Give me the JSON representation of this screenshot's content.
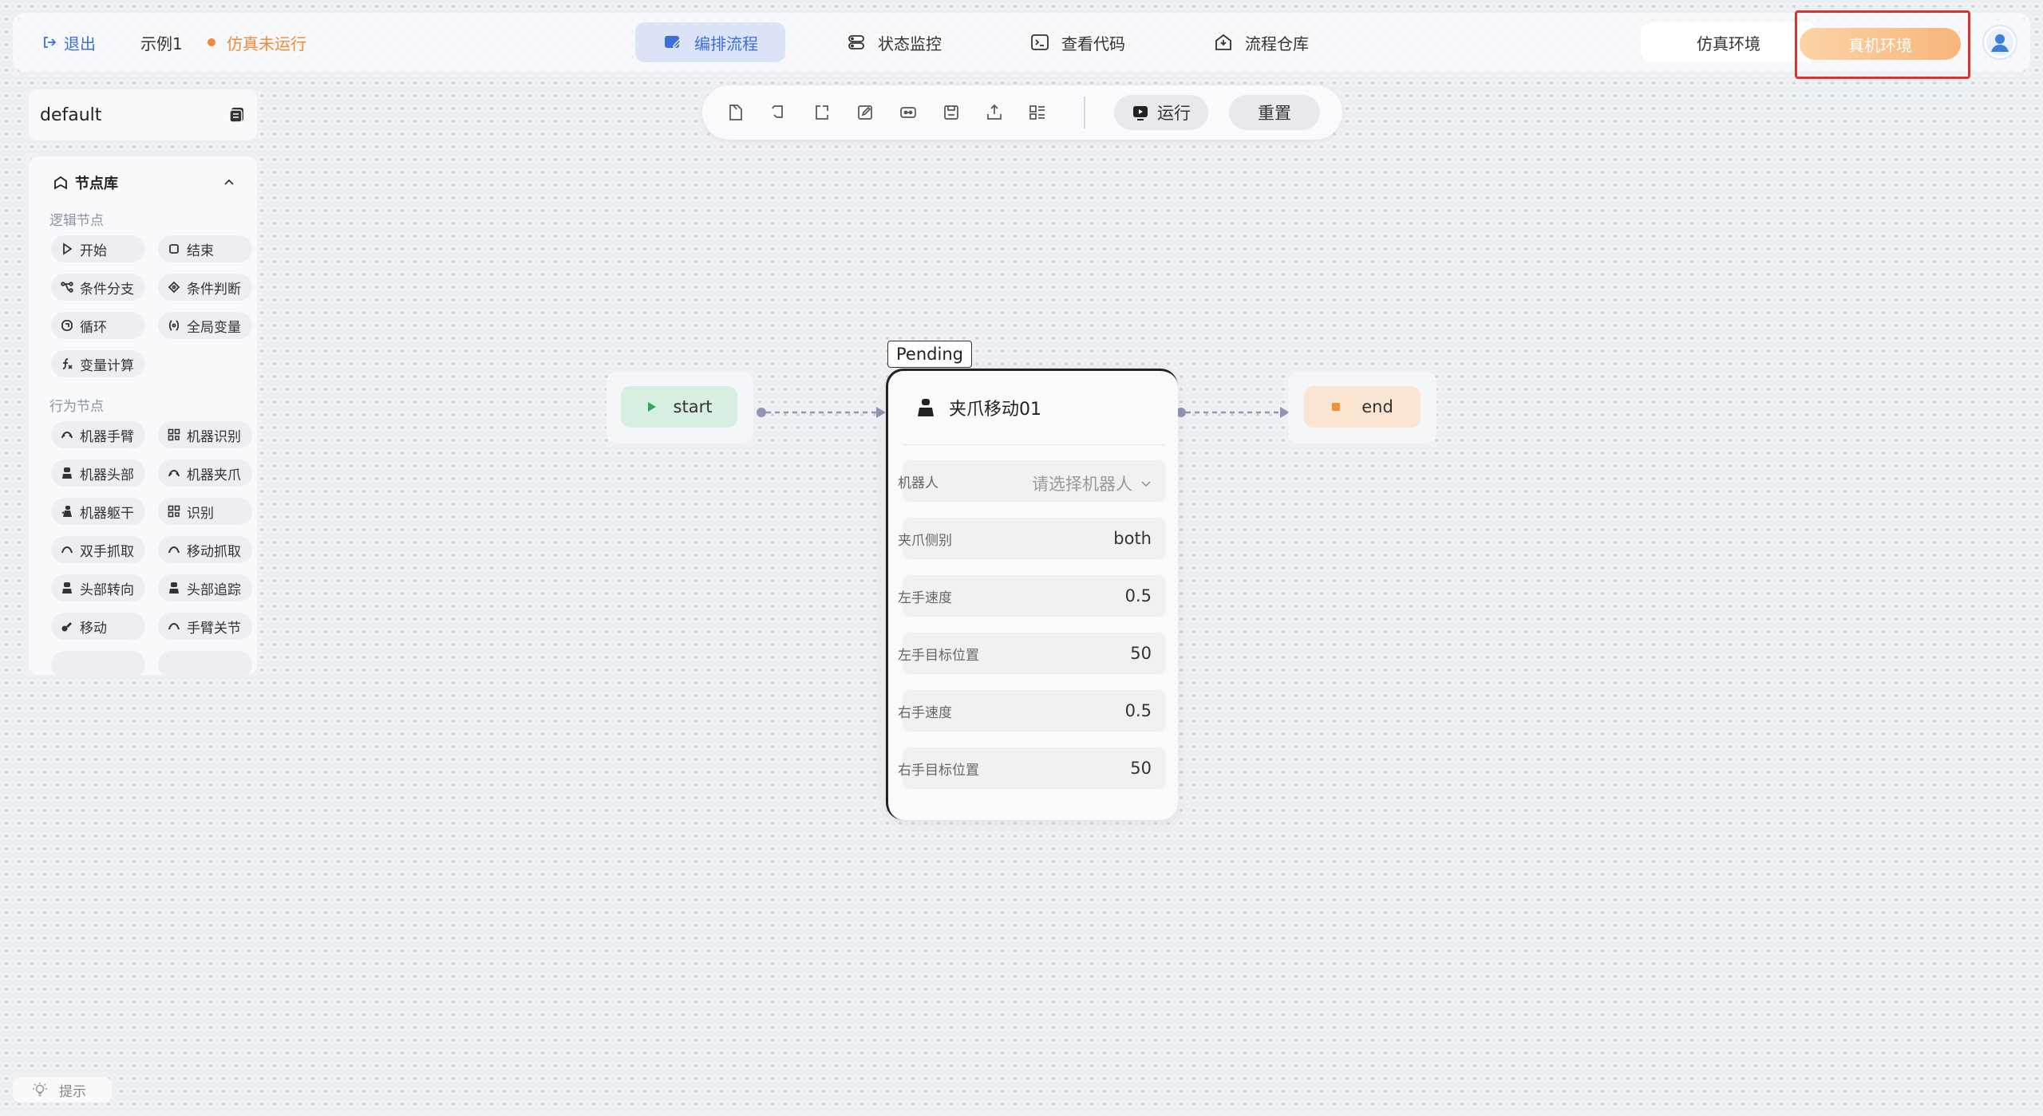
{
  "header": {
    "exit_label": "退出",
    "project_name": "示例1",
    "sim_status": "仿真未运行",
    "tabs": [
      {
        "label": "编排流程",
        "icon": "flow-edit-icon",
        "active": true
      },
      {
        "label": "状态监控",
        "icon": "monitor-icon",
        "active": false
      },
      {
        "label": "查看代码",
        "icon": "code-icon",
        "active": false
      },
      {
        "label": "流程仓库",
        "icon": "repository-icon",
        "active": false
      }
    ],
    "env_sim_label": "仿真环境",
    "env_real_label": "真机环境"
  },
  "project_panel": {
    "name": "default"
  },
  "node_library": {
    "title": "节点库",
    "logic_title": "逻辑节点",
    "logic_nodes": [
      {
        "label": "开始",
        "icon": "play-icon"
      },
      {
        "label": "结束",
        "icon": "stop-square-icon"
      },
      {
        "label": "条件分支",
        "icon": "branch-icon"
      },
      {
        "label": "条件判断",
        "icon": "diamond-icon"
      },
      {
        "label": "循环",
        "icon": "loop-icon"
      },
      {
        "label": "全局变量",
        "icon": "variable-icon"
      },
      {
        "label": "变量计算",
        "icon": "function-icon"
      }
    ],
    "behavior_title": "行为节点",
    "behavior_nodes": [
      {
        "label": "机器手臂",
        "icon": "robot-arm-icon"
      },
      {
        "label": "机器识别",
        "icon": "qr-icon"
      },
      {
        "label": "机器头部",
        "icon": "robot-head-icon"
      },
      {
        "label": "机器夹爪",
        "icon": "gripper-icon"
      },
      {
        "label": "机器躯干",
        "icon": "robot-torso-icon"
      },
      {
        "label": "识别",
        "icon": "qr-icon"
      },
      {
        "label": "双手抓取",
        "icon": "gripper-icon"
      },
      {
        "label": "移动抓取",
        "icon": "gripper-icon"
      },
      {
        "label": "头部转向",
        "icon": "robot-head-icon"
      },
      {
        "label": "头部追踪",
        "icon": "robot-head-icon"
      },
      {
        "label": "移动",
        "icon": "move-icon"
      },
      {
        "label": "手臂关节",
        "icon": "robot-arm-icon"
      }
    ]
  },
  "toolbar": {
    "tools": [
      "new-file-icon",
      "undo-icon",
      "export-icon",
      "edit-icon",
      "link-icon",
      "save-icon",
      "upload-icon",
      "layout-icon"
    ],
    "run_label": "运行",
    "reset_label": "重置"
  },
  "canvas": {
    "start_label": "start",
    "end_label": "end",
    "status_tag": "Pending",
    "node": {
      "title": "夹爪移动01",
      "fields": [
        {
          "label": "机器人",
          "value": "请选择机器人",
          "placeholder": true
        },
        {
          "label": "夹爪侧别",
          "value": "both",
          "placeholder": false
        },
        {
          "label": "左手速度",
          "value": "0.5",
          "placeholder": false
        },
        {
          "label": "左手目标位置",
          "value": "50",
          "placeholder": false
        },
        {
          "label": "右手速度",
          "value": "0.5",
          "placeholder": false
        },
        {
          "label": "右手目标位置",
          "value": "50",
          "placeholder": false
        }
      ]
    }
  },
  "hint_label": "提示",
  "colors": {
    "accent": "#3d6ee0",
    "warning": "#ef8a3a",
    "real_env": "#f8b57a",
    "highlight_box": "#e03131"
  }
}
